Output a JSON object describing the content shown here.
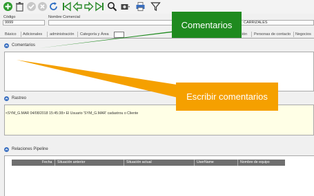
{
  "toolbar": {
    "buttons": [
      {
        "name": "add-icon"
      },
      {
        "name": "delete-icon"
      },
      {
        "name": "confirm-icon"
      },
      {
        "name": "cancel-icon"
      },
      {
        "name": "refresh-icon"
      },
      {
        "name": "first-record-icon"
      },
      {
        "name": "previous-record-icon"
      },
      {
        "name": "next-record-icon"
      },
      {
        "name": "last-record-icon"
      },
      {
        "name": "search-icon"
      },
      {
        "name": "camera-icon"
      },
      {
        "name": "print-icon"
      },
      {
        "name": "filter-icon"
      }
    ]
  },
  "header": {
    "code_label": "Código",
    "code_value": "9999",
    "trade_name_label": "Nombre Comercial",
    "trade_name_value": "CARRIZALES"
  },
  "tabs": {
    "items": [
      "Básico",
      "Adicionales",
      "administración",
      "Categoría y Área",
      "",
      "pción",
      "Personas de contacto",
      "Negocios"
    ]
  },
  "sections": {
    "comments_title": "Comentarios",
    "tracking_title": "Rastreo",
    "tracking_text": "<SYM_G.MAR 04/08/2018 15:45:38> El Usuario 'SYM_G.MAR' cadastrou o Cliente",
    "pipeline_title": "Relaciones Pipeline"
  },
  "grid": {
    "columns": [
      "Fecha",
      "Situación anterior",
      "Situación actual",
      "UserName",
      "Nombre de equipo"
    ]
  },
  "callouts": {
    "comments_label": "Comentarios",
    "write_comments_label": "Escribir comentarios"
  },
  "colors": {
    "callout_green": "#1f8a1f",
    "callout_orange": "#f5a000",
    "section_chevron": "#3a6fc0",
    "grid_header": "#6f6f6f",
    "tracking_background": "#ffffe6"
  }
}
